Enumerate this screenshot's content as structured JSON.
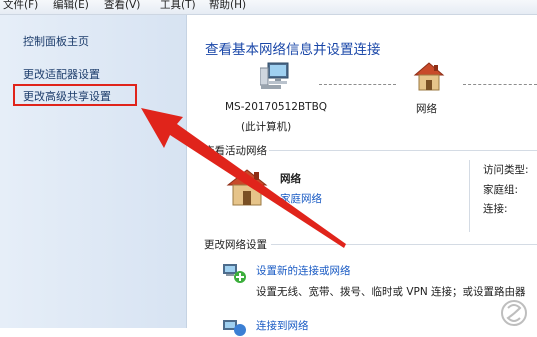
{
  "menu": [
    "文件(F)",
    "编辑(E)",
    "查看(V)",
    "工具(T)",
    "帮助(H)"
  ],
  "sidebar": {
    "items": [
      "控制面板主页",
      "更改适配器设置",
      "更改高级共享设置"
    ]
  },
  "main": {
    "title": "查看基本网络信息并设置连接",
    "computer_name": "MS-20170512BTBQ",
    "computer_sub": "(此计算机)",
    "network_node": "网络",
    "active_label": "查看活动网络",
    "network_name": "网络",
    "network_type": "家庭网络",
    "access_type_label": "访问类型:",
    "homegroup_label": "家庭组:",
    "connection_label": "连接:",
    "change_label": "更改网络设置",
    "setup_link": "设置新的连接或网络",
    "setup_desc": "设置无线、宽带、拨号、临时或 VPN 连接；或设置路由器",
    "connect_link": "连接到网络"
  },
  "colors": {
    "accent": "#1a47a8",
    "link": "#1a5bc4",
    "highlight": "#e0241b"
  }
}
